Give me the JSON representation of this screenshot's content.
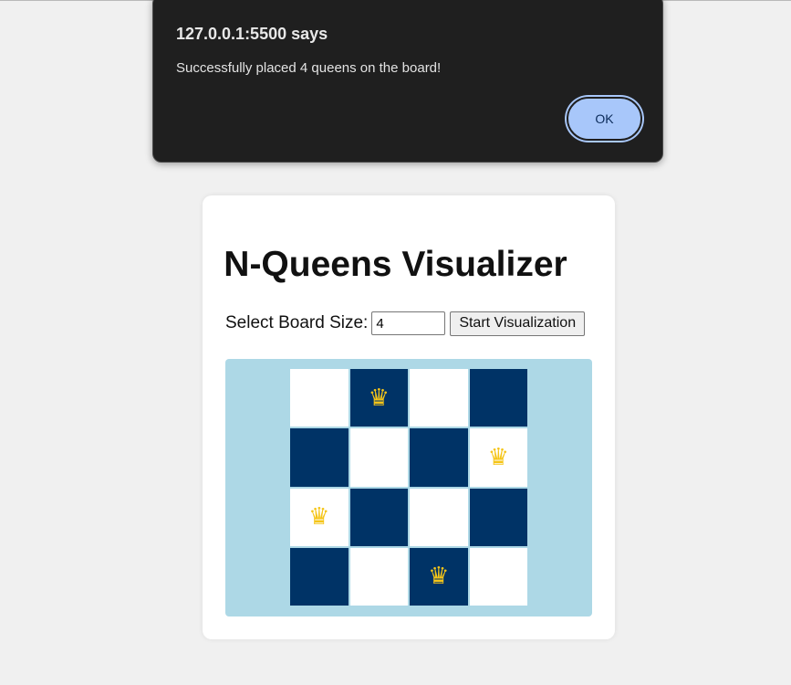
{
  "alert": {
    "title": "127.0.0.1:5500 says",
    "message": "Successfully placed 4 queens on the board!",
    "ok_label": "OK"
  },
  "app": {
    "title": "N-Queens Visualizer",
    "size_label": "Select Board Size:",
    "size_value": "4",
    "start_label": "Start Visualization"
  },
  "board": {
    "size": 4,
    "queen_glyph": "♛",
    "queen_color": "#f5c518",
    "dark_color": "#003366",
    "light_color": "#ffffff",
    "queen_columns_by_row": [
      1,
      3,
      0,
      2
    ]
  }
}
